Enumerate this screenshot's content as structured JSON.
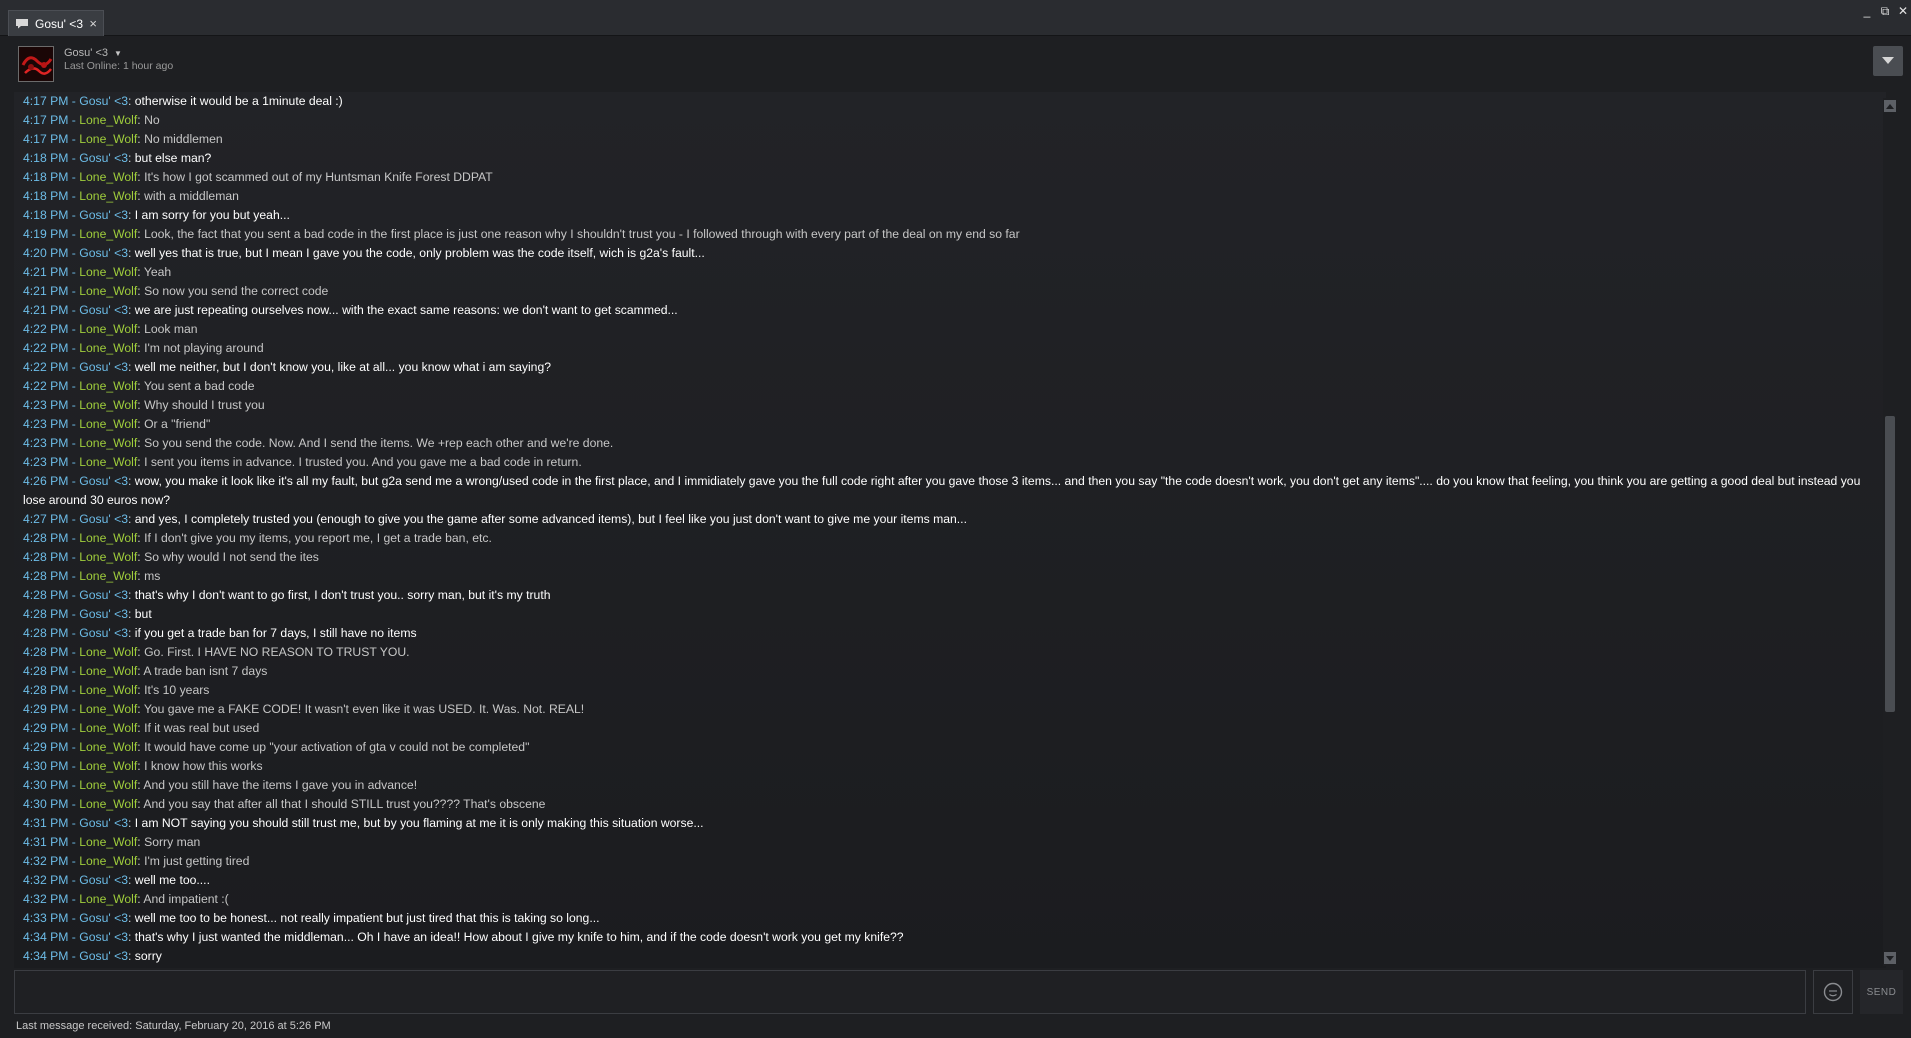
{
  "tab": {
    "title": "Gosu' <3",
    "close": "×"
  },
  "window_controls": {
    "minimize": "_",
    "restore": "⧉",
    "close": "✕"
  },
  "header": {
    "friend_name": "Gosu' <3",
    "caret": "▼",
    "last_online": "Last Online: 1 hour ago"
  },
  "messages": [
    {
      "time": "4:17 PM",
      "sender": "Gosu' <3",
      "text": "otherwise it would be a 1minute deal :)"
    },
    {
      "time": "4:17 PM",
      "sender": "Lone_Wolf",
      "text": "No"
    },
    {
      "time": "4:17 PM",
      "sender": "Lone_Wolf",
      "text": "No middlemen"
    },
    {
      "time": "4:18 PM",
      "sender": "Gosu' <3",
      "text": "but else man?"
    },
    {
      "time": "4:18 PM",
      "sender": "Lone_Wolf",
      "text": "It's how I got scammed out of my Huntsman Knife Forest DDPAT"
    },
    {
      "time": "4:18 PM",
      "sender": "Lone_Wolf",
      "text": "with a middleman"
    },
    {
      "time": "4:18 PM",
      "sender": "Gosu' <3",
      "text": "I am sorry for you but yeah..."
    },
    {
      "time": "4:19 PM",
      "sender": "Lone_Wolf",
      "text": "Look, the fact that you sent a bad code in the first place is just one reason why I shouldn't trust you - I followed through with every part of the deal on my end so far"
    },
    {
      "time": "4:20 PM",
      "sender": "Gosu' <3",
      "text": "well yes that is true, but I mean I gave you the code, only problem was the code itself, wich is g2a's fault..."
    },
    {
      "time": "4:21 PM",
      "sender": "Lone_Wolf",
      "text": "Yeah"
    },
    {
      "time": "4:21 PM",
      "sender": "Lone_Wolf",
      "text": "So now you send the correct code"
    },
    {
      "time": "4:21 PM",
      "sender": "Gosu' <3",
      "text": "we are just repeating ourselves now... with the exact same reasons: we don't want to get scammed..."
    },
    {
      "time": "4:22 PM",
      "sender": "Lone_Wolf",
      "text": "Look man"
    },
    {
      "time": "4:22 PM",
      "sender": "Lone_Wolf",
      "text": "I'm not playing around"
    },
    {
      "time": "4:22 PM",
      "sender": "Gosu' <3",
      "text": "well me neither, but I don't know you, like at all... you know what i am saying?"
    },
    {
      "time": "4:22 PM",
      "sender": "Lone_Wolf",
      "text": "You sent a bad code"
    },
    {
      "time": "4:23 PM",
      "sender": "Lone_Wolf",
      "text": "Why should I trust you"
    },
    {
      "time": "4:23 PM",
      "sender": "Lone_Wolf",
      "text": "Or a \"friend\""
    },
    {
      "time": "4:23 PM",
      "sender": "Lone_Wolf",
      "text": "So you send the code. Now. And I send the items. We +rep each other and we're done."
    },
    {
      "time": "4:23 PM",
      "sender": "Lone_Wolf",
      "text": "I sent you items in advance. I trusted you. And you gave me a bad code in return."
    },
    {
      "time": "4:26 PM",
      "sender": "Gosu' <3",
      "text": "wow, you make it look like it's all my fault, but g2a send me a wrong/used code in the first place, and I immidiately gave you the full code right after you gave those 3 items... and then you say \"the code doesn't work, you don't get any items\".... do you know that feeling, you think you are getting a good deal but instead you lose around 30 euros now?"
    },
    {
      "time": "4:27 PM",
      "sender": "Gosu' <3",
      "text": "and yes, I completely trusted you (enough to give you the game after some advanced items), but I feel like you just don't want to give me your items man..."
    },
    {
      "time": "4:28 PM",
      "sender": "Lone_Wolf",
      "text": "If I don't give you my items, you report me, I get a trade ban, etc."
    },
    {
      "time": "4:28 PM",
      "sender": "Lone_Wolf",
      "text": "So why would I not send the ites"
    },
    {
      "time": "4:28 PM",
      "sender": "Lone_Wolf",
      "text": "ms"
    },
    {
      "time": "4:28 PM",
      "sender": "Gosu' <3",
      "text": "that's why I don't want to go first, I don't trust you.. sorry man, but it's my truth"
    },
    {
      "time": "4:28 PM",
      "sender": "Gosu' <3",
      "text": "but"
    },
    {
      "time": "4:28 PM",
      "sender": "Gosu' <3",
      "text": "if you get a trade ban for 7 days, I still have no items"
    },
    {
      "time": "4:28 PM",
      "sender": "Lone_Wolf",
      "text": "Go. First. I HAVE NO REASON TO TRUST YOU."
    },
    {
      "time": "4:28 PM",
      "sender": "Lone_Wolf",
      "text": "A trade ban isnt 7 days"
    },
    {
      "time": "4:28 PM",
      "sender": "Lone_Wolf",
      "text": "It's 10 years"
    },
    {
      "time": "4:29 PM",
      "sender": "Lone_Wolf",
      "text": "You gave me a FAKE CODE! It wasn't even like it was USED. It. Was. Not. REAL!"
    },
    {
      "time": "4:29 PM",
      "sender": "Lone_Wolf",
      "text": "If it was real but used"
    },
    {
      "time": "4:29 PM",
      "sender": "Lone_Wolf",
      "text": "It would have come up \"your activation of gta v could not be completed\""
    },
    {
      "time": "4:30 PM",
      "sender": "Lone_Wolf",
      "text": "I know how this works"
    },
    {
      "time": "4:30 PM",
      "sender": "Lone_Wolf",
      "text": "And you still have the items I gave you in advance!"
    },
    {
      "time": "4:30 PM",
      "sender": "Lone_Wolf",
      "text": "And you say that after all that I should STILL trust you???? That's obscene"
    },
    {
      "time": "4:31 PM",
      "sender": "Gosu' <3",
      "text": "I am NOT saying you should still trust me, but by you flaming at me it is only making this situation worse..."
    },
    {
      "time": "4:31 PM",
      "sender": "Lone_Wolf",
      "text": "Sorry man"
    },
    {
      "time": "4:32 PM",
      "sender": "Lone_Wolf",
      "text": "I'm just getting tired"
    },
    {
      "time": "4:32 PM",
      "sender": "Gosu' <3",
      "text": "well me too...."
    },
    {
      "time": "4:32 PM",
      "sender": "Lone_Wolf",
      "text": "And impatient :("
    },
    {
      "time": "4:33 PM",
      "sender": "Gosu' <3",
      "text": "well me too to be honest... not really impatient but just tired that this is taking so long..."
    },
    {
      "time": "4:34 PM",
      "sender": "Gosu' <3",
      "text": "that's why I just wanted the middleman... Oh I have an idea!! How about I give my knife to him, and if the code doesn't work you get my knife??"
    },
    {
      "time": "4:34 PM",
      "sender": "Gosu' <3",
      "text": "sorry"
    }
  ],
  "input": {
    "value": "",
    "placeholder": ""
  },
  "send_label": "SEND",
  "footer": {
    "last_received": "Last message received: Saturday, February 20, 2016 at 5:26 PM"
  },
  "colors": {
    "timestamp": "#6dbde8",
    "gosu": "#6dbde8",
    "lone_wolf": "#9fcd3c",
    "background": "#1e1f22"
  }
}
